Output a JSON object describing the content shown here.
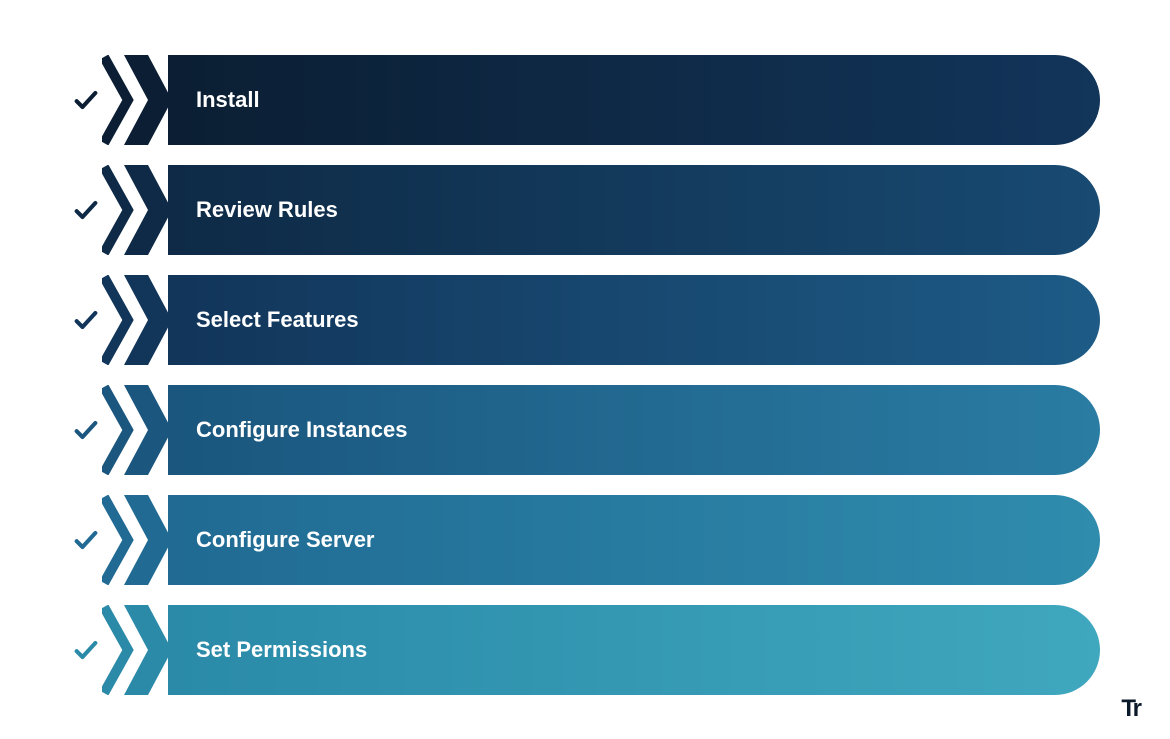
{
  "steps": [
    {
      "label": "Install",
      "checkColor": "#0b1e33",
      "barFrom": "#0b1e33",
      "barTo": "#12355a",
      "chevFill": "#0b1e33"
    },
    {
      "label": "Review Rules",
      "checkColor": "#0e2a46",
      "barFrom": "#0e2a46",
      "barTo": "#184a72",
      "chevFill": "#0e2a46"
    },
    {
      "label": "Select Features",
      "checkColor": "#12355a",
      "barFrom": "#12355a",
      "barTo": "#1d5b86",
      "chevFill": "#12355a"
    },
    {
      "label": "Configure Instances",
      "checkColor": "#1a567e",
      "barFrom": "#1a567e",
      "barTo": "#2a7ca3",
      "chevFill": "#1a567e"
    },
    {
      "label": "Configure Server",
      "checkColor": "#206a93",
      "barFrom": "#206a93",
      "barTo": "#2f8cad",
      "chevFill": "#206a93"
    },
    {
      "label": "Set Permissions",
      "checkColor": "#2a8aa8",
      "barFrom": "#2a8aa8",
      "barTo": "#3fa7be",
      "chevFill": "#2a8aa8"
    }
  ],
  "logoText": "Tr"
}
